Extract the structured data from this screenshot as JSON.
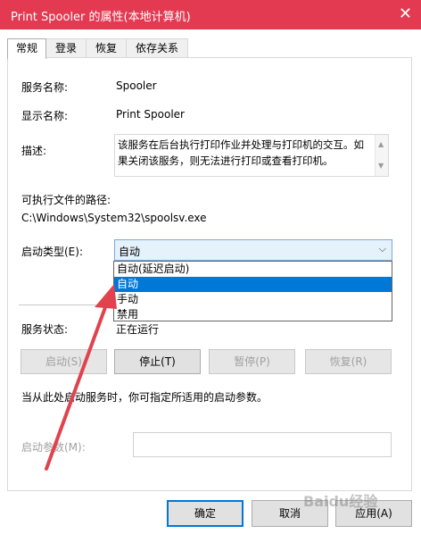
{
  "window": {
    "title": "Print Spooler 的属性(本地计算机)"
  },
  "tabs": [
    {
      "label": "常规"
    },
    {
      "label": "登录"
    },
    {
      "label": "恢复"
    },
    {
      "label": "依存关系"
    }
  ],
  "general": {
    "service_name_label": "服务名称:",
    "service_name_value": "Spooler",
    "display_name_label": "显示名称:",
    "display_name_value": "Print Spooler",
    "description_label": "描述:",
    "description_value": "该服务在后台执行打印作业并处理与打印机的交互。如果关闭该服务，则无法进行打印或查看打印机。",
    "exe_path_label": "可执行文件的路径:",
    "exe_path_value": "C:\\Windows\\System32\\spoolsv.exe",
    "startup_type_label": "启动类型(E):",
    "startup_type_value": "自动",
    "startup_options": [
      "自动(延迟启动)",
      "自动",
      "手动",
      "禁用"
    ],
    "service_status_label": "服务状态:",
    "service_status_value": "正在运行",
    "buttons": {
      "start": "启动(S)",
      "stop": "停止(T)",
      "pause": "暂停(P)",
      "resume": "恢复(R)"
    },
    "hint": "当从此处启动服务时，你可指定所适用的启动参数。",
    "start_params_label": "启动参数(M):",
    "start_params_value": ""
  },
  "footer": {
    "ok": "确定",
    "cancel": "取消",
    "apply": "应用(A)"
  },
  "watermark": "Baidu经验",
  "colors": {
    "titlebar": "#e33a52",
    "selection": "#0078d7",
    "arrow": "#e0434d"
  }
}
